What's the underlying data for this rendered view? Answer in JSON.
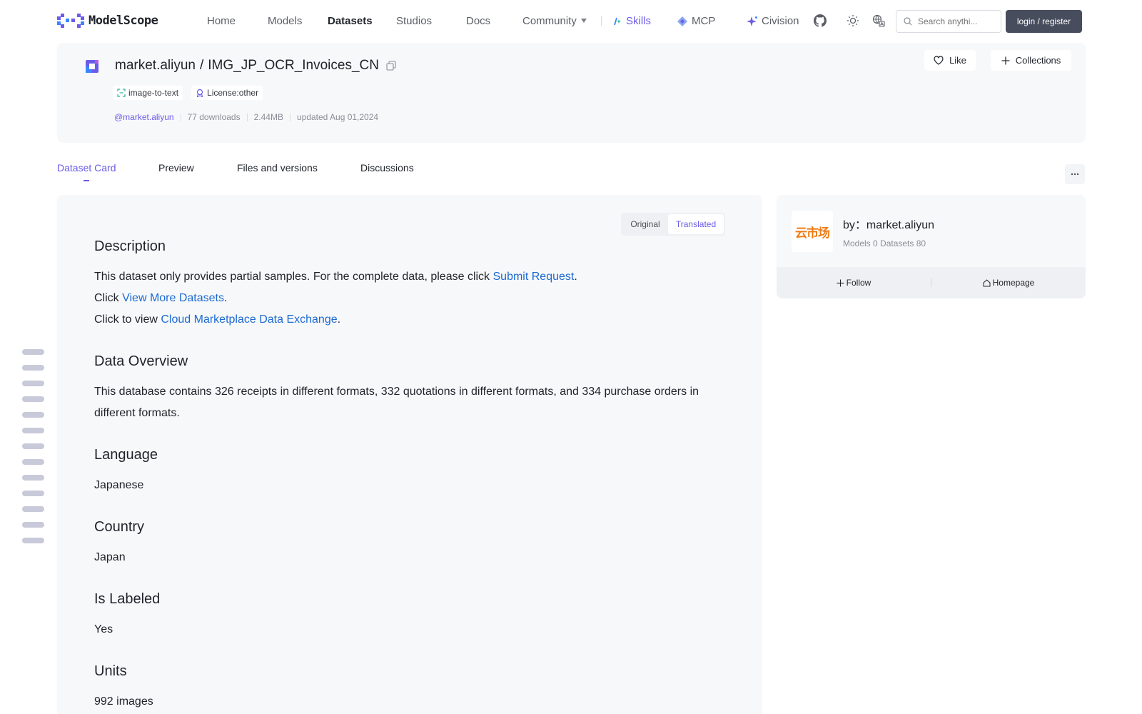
{
  "nav": {
    "logo_text": "ModelScope",
    "links": [
      "Home",
      "Models",
      "Datasets",
      "Studios",
      "Docs",
      "Community"
    ],
    "skills": "Skills",
    "mcp": "MCP",
    "civision": "Civision",
    "search_placeholder": "Search anythi...",
    "login": "login / register",
    "icons": [
      "github-icon",
      "theme-sun-icon",
      "language-icon",
      "search-icon"
    ]
  },
  "dataset": {
    "owner": "market.aliyun",
    "separator": "/",
    "name": "IMG_JP_OCR_Invoices_CN",
    "tags": [
      "image-to-text",
      "License:other"
    ],
    "owner_handle": "@market.aliyun",
    "downloads": "77 downloads",
    "size": "2.44MB",
    "updated": "updated Aug 01,2024",
    "like": "Like",
    "collections": "Collections"
  },
  "tabs": [
    "Dataset Card",
    "Preview",
    "Files and versions",
    "Discussions"
  ],
  "toggle": {
    "original": "Original",
    "translated": "Translated"
  },
  "article": {
    "description_title": "Description",
    "desc_line1_pre": "This dataset only provides partial samples. For the complete data, please click ",
    "desc_line1_link": "Submit Request",
    "desc_line1_post": ".",
    "desc_line2_pre": "Click ",
    "desc_line2_link": "View More Datasets",
    "desc_line2_post": ".",
    "desc_line3_pre": "Click to view ",
    "desc_line3_link": "Cloud Marketplace Data Exchange",
    "desc_line3_post": ".",
    "overview_title": "Data Overview",
    "overview_text": "This database contains 326 receipts in different formats, 332 quotations in different formats, and 334 purchase orders in different formats.",
    "language_title": "Language",
    "language_value": "Japanese",
    "country_title": "Country",
    "country_value": "Japan",
    "labeled_title": "Is Labeled",
    "labeled_value": "Yes",
    "units_title": "Units",
    "units_value": "992 images"
  },
  "owner_card": {
    "logo_text": "云市场",
    "by": "by：market.aliyun",
    "stats": "Models 0  Datasets 80",
    "follow": "Follow",
    "homepage": "Homepage"
  },
  "colors": {
    "accent": "#6b5ce7",
    "link": "#1c6ad1",
    "brand_orange": "#f07a12",
    "login_bg": "#474d5c"
  }
}
